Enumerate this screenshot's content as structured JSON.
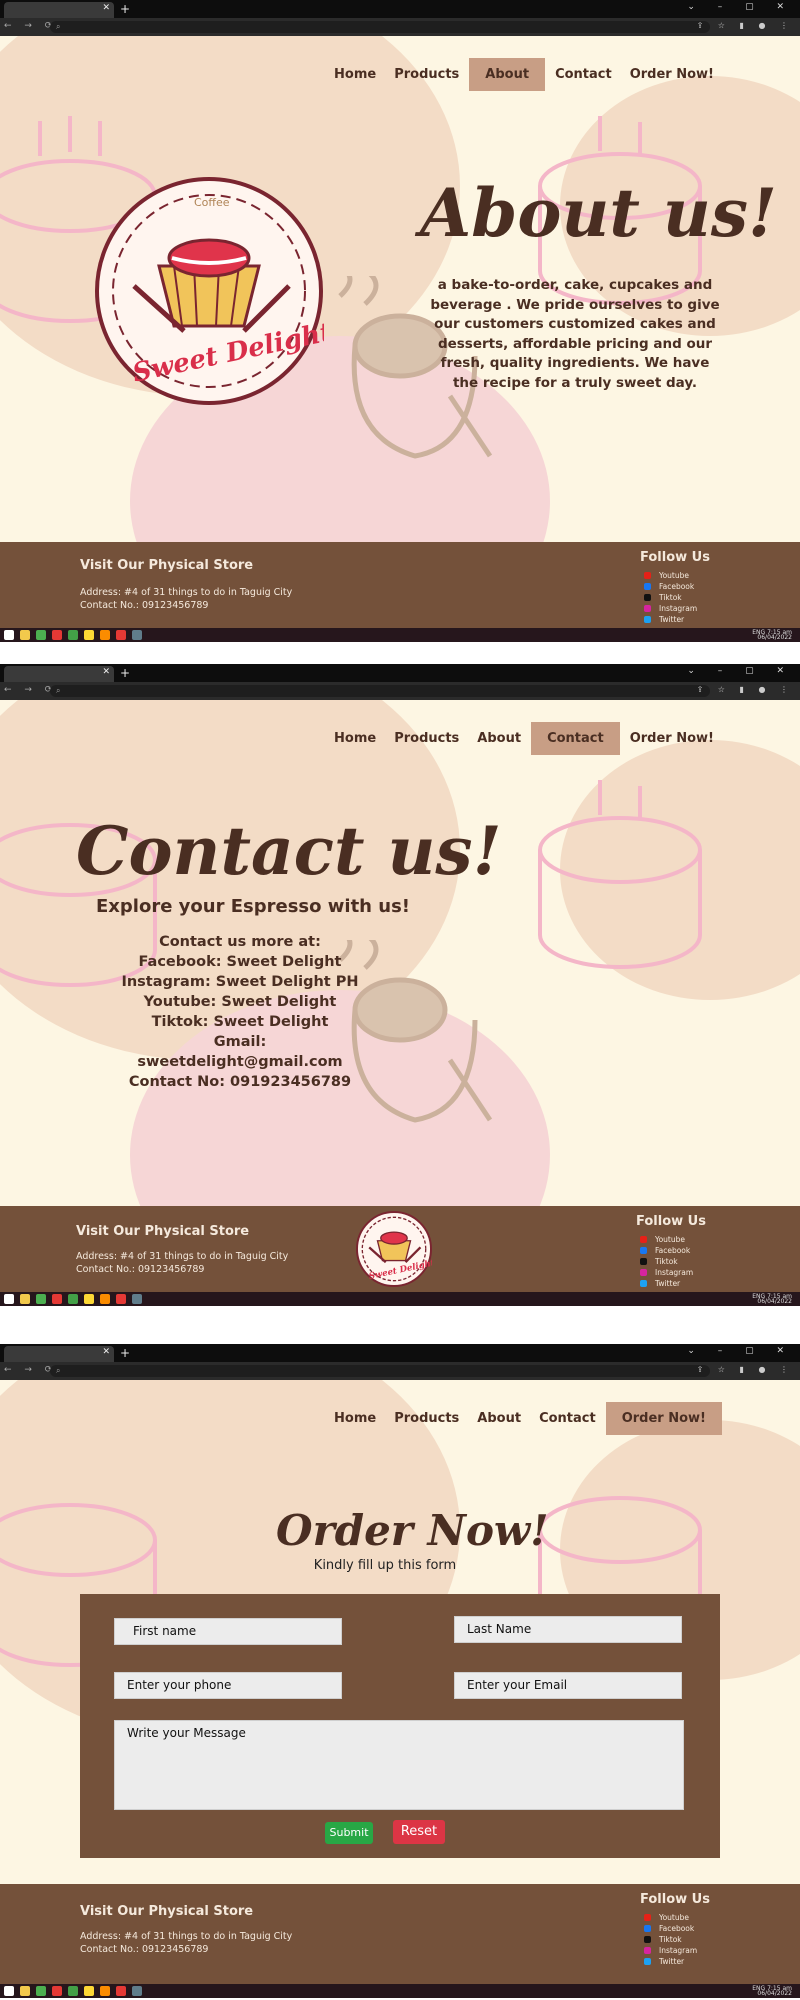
{
  "nav": {
    "home": "Home",
    "products": "Products",
    "about": "About",
    "contact": "Contact",
    "order": "Order Now!"
  },
  "about_page": {
    "title": "About us!",
    "logo_arc_text": "Coffee",
    "logo_text": "Sweet Delight",
    "description": "a bake-to-order, cake,  cupcakes and beverage . We pride ourselves to give our customers customized cakes and desserts, affordable pricing and our fresh, quality ingredients. We have the recipe for a truly sweet day."
  },
  "contact_page": {
    "title": "Contact us!",
    "subtitle": "Explore your Espresso with us!",
    "lines": [
      "Contact us more at:",
      "Facebook: Sweet Delight",
      "Instagram: Sweet Delight PH",
      "Youtube: Sweet Delight",
      "Tiktok: Sweet Delight",
      "Gmail: sweetdelight@gmail.com",
      "Contact No: 091923456789"
    ]
  },
  "order_page": {
    "title": "Order Now!",
    "subtitle": "Kindly fill up this form",
    "first_name": "First name",
    "last_name": "Last Name",
    "phone": "Enter your phone",
    "email": "Enter your Email",
    "message": "Write your Message",
    "submit": "Submit",
    "reset": "Reset"
  },
  "footer": {
    "store_title": "Visit Our Physical Store",
    "address": "Address: #4 of 31 things to do in Taguig City",
    "contact": "Contact No.: 09123456789",
    "follow_title": "Follow Us",
    "social": [
      "Youtube",
      "Facebook",
      "Tiktok",
      "Instagram",
      "Twitter"
    ]
  },
  "taskbar": {
    "lang": "ENG",
    "time": "7:15 am",
    "date": "06/04/2022"
  },
  "colors": {
    "cream": "#fdf6e3",
    "brown": "#74513a",
    "dark_text": "#4a2e22",
    "nav_active": "#c89e85",
    "submit": "#28a745",
    "reset": "#dc3545"
  }
}
